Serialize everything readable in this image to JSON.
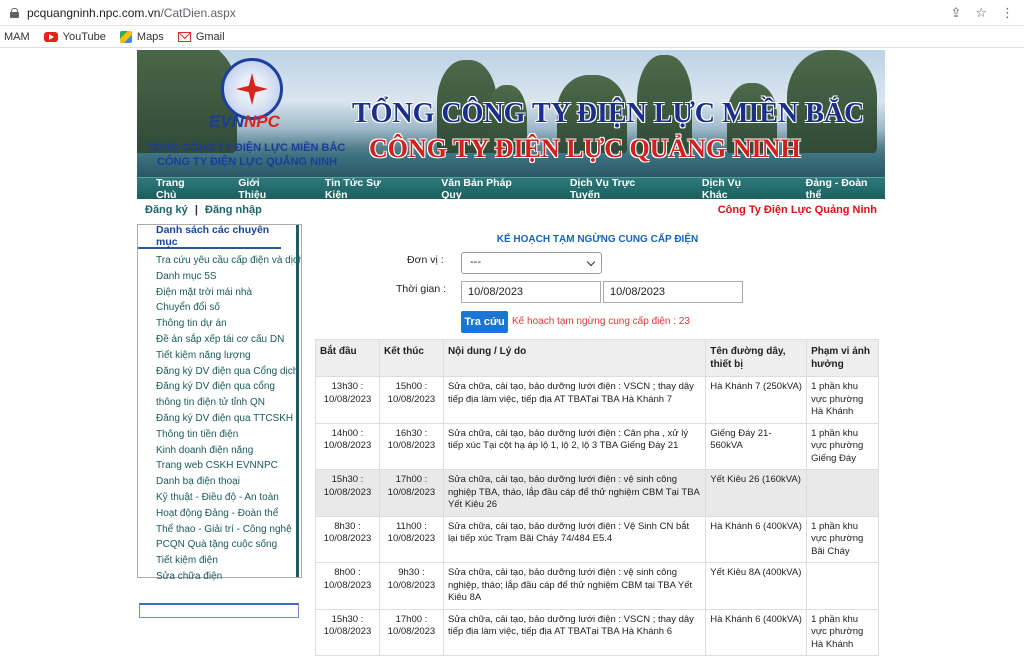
{
  "browser": {
    "url_domain": "pcquangninh.npc.com.vn",
    "url_path": "/CatDien.aspx",
    "bookmarks": [
      "MAM",
      "YouTube",
      "Maps",
      "Gmail"
    ]
  },
  "banner": {
    "logo_text_a": "EVN",
    "logo_text_b": "NPC",
    "small_line1": "TỔNG CÔNG TY ĐIỆN LỰC MIỀN BẮC",
    "small_line2": "CÔNG TY ĐIỆN LỰC QUẢNG NINH",
    "big_line1": "TỔNG CÔNG TY ĐIỆN LỰC MIỀN BẮC",
    "big_line2": "CÔNG TY ĐIỆN LỰC QUẢNG NINH"
  },
  "nav": {
    "items": [
      "Trang Chủ",
      "Giới Thiệu",
      "Tin Tức Sự Kiện",
      "Văn Bản Pháp Quy",
      "Dịch Vụ Trực Tuyến",
      "Dịch Vụ Khác",
      "Đảng - Đoàn thể"
    ]
  },
  "subbar": {
    "register": "Đăng ký",
    "sep": "|",
    "login": "Đăng nhập",
    "org": "Công Ty Điện Lực Quảng Ninh"
  },
  "sidebar": {
    "title": "Danh sách các chuyên mục",
    "items": [
      "Tra cứu yêu cầu cấp điện và dịch vụ",
      "Danh mục 5S",
      "Điện mặt trời mái nhà",
      "Chuyển đổi số",
      "Thông tin dự án",
      "Đề án sắp xếp tái cơ cấu DN",
      "Tiết kiệm năng lượng",
      "Đăng ký DV điện qua Cổng dịch vụ",
      "Đăng ký DV điện qua cổng",
      "thông tin điện tử tỉnh QN",
      "Đăng ký DV điện qua TTCSKH",
      "Thông tin tiền điện",
      "Kinh doanh điện năng",
      "Trang web CSKH EVNNPC",
      "Danh bạ điện thoại",
      "Kỹ thuật - Điều độ - An toàn",
      "Hoạt động Đảng - Đoàn thể",
      "Thể thao - Giải trí - Công nghệ",
      "PCQN Quà tặng cuộc sống",
      "Tiết kiệm điện",
      "Sửa chữa điện"
    ]
  },
  "main": {
    "title": "KẾ HOẠCH TẠM NGỪNG CUNG CẤP ĐIỆN",
    "unit_label": "Đơn vị :",
    "unit_value": "---",
    "time_label": "Thời gian :",
    "date_from": "10/08/2023",
    "date_to": "10/08/2023",
    "search_button": "Tra cứu",
    "count_text": "Kế hoạch tạm ngừng cung cấp điện : 23"
  },
  "table": {
    "headers": [
      "Bắt đầu",
      "Kết thúc",
      "Nội dung / Lý do",
      "Tên đường dây, thiết bị",
      "Phạm vi ảnh hưởng"
    ],
    "rows": [
      [
        "13h30 : 10/08/2023",
        "15h00 : 10/08/2023",
        "Sửa chữa, cải tạo, bảo dưỡng lưới điện : VSCN ; thay dây tiếp địa làm việc, tiếp địa AT TBATại TBA Hà Khánh 7",
        "Hà Khánh 7 (250kVA)",
        "1 phần khu vực phường Hà Khánh"
      ],
      [
        "14h00 : 10/08/2023",
        "16h30 : 10/08/2023",
        "Sửa chữa, cải tạo, bảo dưỡng lưới điện : Cân pha , xử lý tiếp xúc Tại cột hạ áp lộ 1, lộ 2, lộ 3 TBA Giếng Đáy 21",
        "Giếng Đáy 21-560kVA",
        "1 phần khu vực phường Giếng Đáy"
      ],
      [
        "15h30 : 10/08/2023",
        "17h00 : 10/08/2023",
        "Sửa chữa, cải tạo, bảo dưỡng lưới điện : vệ sinh công nghiệp TBA, tháo, lắp đầu cáp để thử nghiệm CBM Tại TBA Yết Kiêu 26",
        "Yết Kiêu 26 (160kVA)",
        ""
      ],
      [
        "8h30 : 10/08/2023",
        "11h00 : 10/08/2023",
        "Sửa chữa, cải tạo, bảo dưỡng lưới điện : Vệ Sinh CN bắt lại tiếp xúc Trạm Bãi Cháy 74/484 E5.4",
        "Hà Khánh 6 (400kVA)",
        "1 phần khu vực phường Bãi Cháy"
      ],
      [
        "8h00 : 10/08/2023",
        "9h30 : 10/08/2023",
        "Sửa chữa, cải tạo, bảo dưỡng lưới điện : vệ sinh công nghiệp, tháo; lắp đầu cáp để thử nghiệm CBM tại TBA Yết Kiêu 8A",
        "Yết Kiêu 8A (400kVA)",
        ""
      ],
      [
        "15h30 : 10/08/2023",
        "17h00 : 10/08/2023",
        "Sửa chữa, cải tạo, bảo dưỡng lưới điện : VSCN ; thay dây tiếp địa làm việc, tiếp địa AT TBATại TBA Hà Khánh 6",
        "Hà Khánh 6 (400kVA)",
        "1 phần khu vực phường Hà Khánh"
      ]
    ]
  }
}
